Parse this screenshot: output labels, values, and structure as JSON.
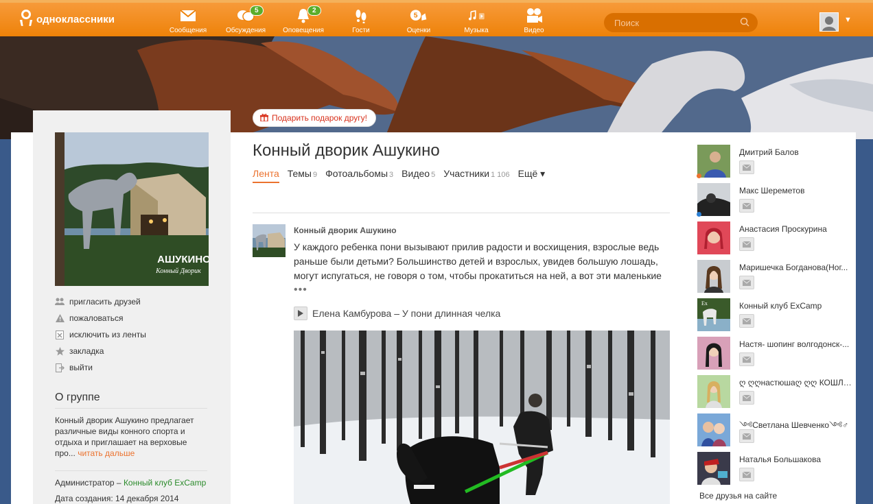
{
  "header": {
    "logo_text": "одноклассники",
    "nav": [
      {
        "label": "Сообщения",
        "icon": "envelope-icon",
        "badge": ""
      },
      {
        "label": "Обсуждения",
        "icon": "discussions-icon",
        "badge": "5"
      },
      {
        "label": "Оповещения",
        "icon": "bell-icon",
        "badge": "2"
      },
      {
        "label": "Гости",
        "icon": "footprints-icon",
        "badge": ""
      },
      {
        "label": "Оценки",
        "icon": "rating-icon",
        "badge": ""
      },
      {
        "label": "Музыка",
        "icon": "music-note-icon",
        "badge": ""
      },
      {
        "label": "Видео",
        "icon": "video-camera-icon",
        "badge": ""
      }
    ],
    "search_placeholder": "Поиск",
    "accent": "#ee8208"
  },
  "gift_label": "Подарить подарок другу!",
  "group": {
    "title": "Конный дворик Ашукино",
    "tabs": [
      {
        "label": "Лента",
        "count": ""
      },
      {
        "label": "Темы",
        "count": "9"
      },
      {
        "label": "Фотоальбомы",
        "count": "3"
      },
      {
        "label": "Видео",
        "count": "5"
      },
      {
        "label": "Участники",
        "count": "1 106"
      },
      {
        "label": "Ещё ▾",
        "count": ""
      }
    ],
    "photo_caption": "АШУКИНО",
    "photo_caption_sub": "Конный Дворик",
    "actions": [
      {
        "label": "пригласить друзей",
        "icon": "people-icon"
      },
      {
        "label": "пожаловаться",
        "icon": "warning-icon"
      },
      {
        "label": "исключить из ленты",
        "icon": "exclude-icon"
      },
      {
        "label": "закладка",
        "icon": "star-icon"
      },
      {
        "label": "выйти",
        "icon": "exit-icon"
      }
    ],
    "about_heading": "О группе",
    "about_text": "Конный дворик Ашукино предлагает различные виды конного спорта и отдыха и приглашает на верховые про...",
    "read_more": "читать дальше",
    "admin_label": "Администратор –",
    "admin_name": "Конный клуб ExCamp",
    "created": "Дата создания: 14 декабря 2014"
  },
  "post": {
    "author": "Конный дворик Ашукино",
    "text": "У каждого ребенка пони вызывают прилив радости и восхищения, взрослые ведь раньше были детьми? Большинство детей и взрослых, увидев большую лошадь, могут испугаться, не говоря о том, чтобы прокатиться на ней, а вот эти маленькие",
    "more": "•••",
    "audio": "Елена Камбурова – У пони длинная челка"
  },
  "friends": [
    {
      "name": "Дмитрий Балов",
      "status": "#eb722e"
    },
    {
      "name": "Макс Шереметов",
      "status": "#2a7fd4"
    },
    {
      "name": "Анастасия Проскурина",
      "status": ""
    },
    {
      "name": "Маришечка Богданова(Ног...",
      "status": ""
    },
    {
      "name": "Конный клуб ExCamp",
      "status": ""
    },
    {
      "name": "Настя- шопинг волгодонск-...",
      "status": ""
    },
    {
      "name": "ღ ღღнастюшаღ ღღ КОШЛЯ...",
      "status": ""
    },
    {
      "name": "༺Светлана Шевченко༺♂",
      "status": ""
    },
    {
      "name": "Наталья Большакова",
      "status": ""
    }
  ],
  "all_friends": "Все друзья на сайте"
}
